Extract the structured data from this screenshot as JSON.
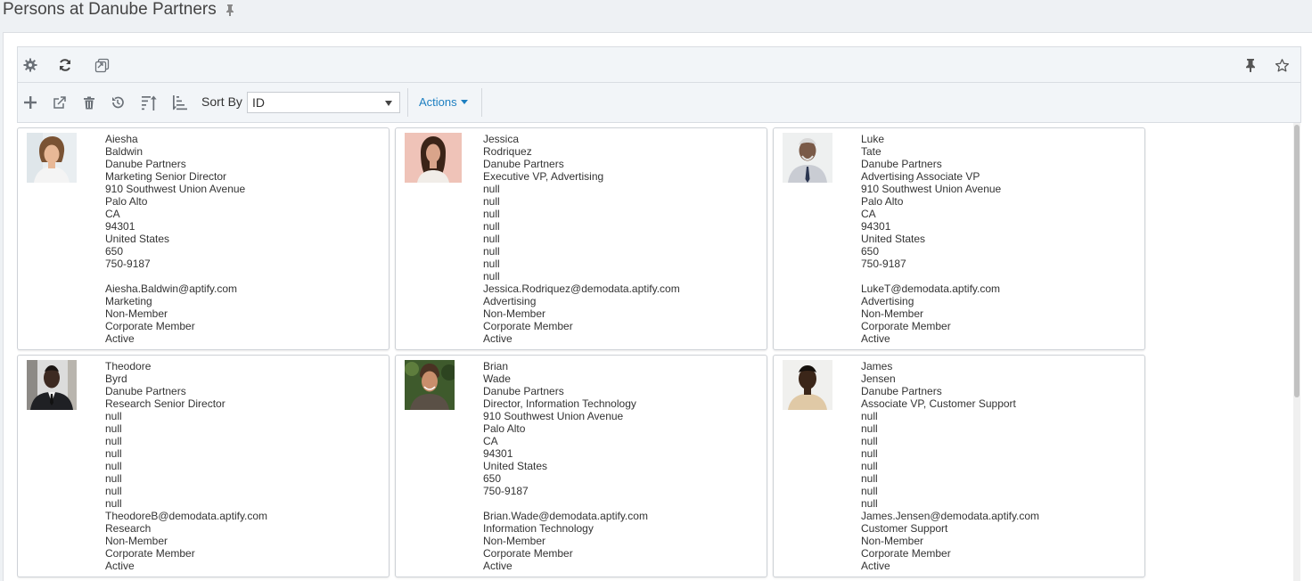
{
  "page": {
    "title": "Persons at Danube Partners"
  },
  "toolbar1": {
    "icons": [
      "gear-icon",
      "refresh-icon",
      "copy-icon",
      "pin-icon",
      "star-icon"
    ]
  },
  "toolbar2": {
    "icons": [
      "add-icon",
      "open-external-icon",
      "trash-icon",
      "history-icon",
      "sort-asc-icon",
      "sort-desc-icon"
    ],
    "sort_label": "Sort By",
    "sort_value": "ID",
    "actions_label": "Actions"
  },
  "colors": {
    "accent": "#1d7fc1",
    "panel_bg": "#f2f5f8",
    "page_bg": "#eef1f4"
  },
  "cards": [
    {
      "photo": "woman-smiling-photo",
      "fields": [
        "Aiesha",
        "Baldwin",
        "Danube Partners",
        "Marketing Senior Director",
        "910 Southwest Union Avenue",
        "Palo Alto",
        "CA",
        "94301",
        "United States",
        "650",
        "750-9187",
        "",
        "Aiesha.Baldwin@aptify.com",
        "Marketing",
        "Non-Member",
        "Corporate Member",
        "Active"
      ]
    },
    {
      "photo": "woman-dark-hair-photo",
      "fields": [
        "Jessica",
        "Rodriquez",
        "Danube Partners",
        "Executive VP, Advertising",
        "null",
        "null",
        "null",
        "null",
        "null",
        "null",
        "null",
        "null",
        "Jessica.Rodriquez@demodata.aptify.com",
        "Advertising",
        "Non-Member",
        "Corporate Member",
        "Active"
      ]
    },
    {
      "photo": "older-man-photo",
      "fields": [
        "Luke",
        "Tate",
        "Danube Partners",
        "Advertising Associate VP",
        "910 Southwest Union Avenue",
        "Palo Alto",
        "CA",
        "94301",
        "United States",
        "650",
        "750-9187",
        "",
        "LukeT@demodata.aptify.com",
        "Advertising",
        "Non-Member",
        "Corporate Member",
        "Active"
      ]
    },
    {
      "photo": "man-suit-photo",
      "fields": [
        "Theodore",
        "Byrd",
        "Danube Partners",
        "Research Senior Director",
        "null",
        "null",
        "null",
        "null",
        "null",
        "null",
        "null",
        "null",
        "TheodoreB@demodata.aptify.com",
        "Research",
        "Non-Member",
        "Corporate Member",
        "Active"
      ]
    },
    {
      "photo": "man-outdoor-photo",
      "fields": [
        "Brian",
        "Wade",
        "Danube Partners",
        "Director, Information Technology",
        "910 Southwest Union Avenue",
        "Palo Alto",
        "CA",
        "94301",
        "United States",
        "650",
        "750-9187",
        "",
        "Brian.Wade@demodata.aptify.com",
        "Information Technology",
        "Non-Member",
        "Corporate Member",
        "Active"
      ]
    },
    {
      "photo": "young-man-photo",
      "fields": [
        "James",
        "Jensen",
        "Danube Partners",
        "Associate VP, Customer Support",
        "null",
        "null",
        "null",
        "null",
        "null",
        "null",
        "null",
        "null",
        "James.Jensen@demodata.aptify.com",
        "Customer Support",
        "Non-Member",
        "Corporate Member",
        "Active"
      ]
    }
  ]
}
